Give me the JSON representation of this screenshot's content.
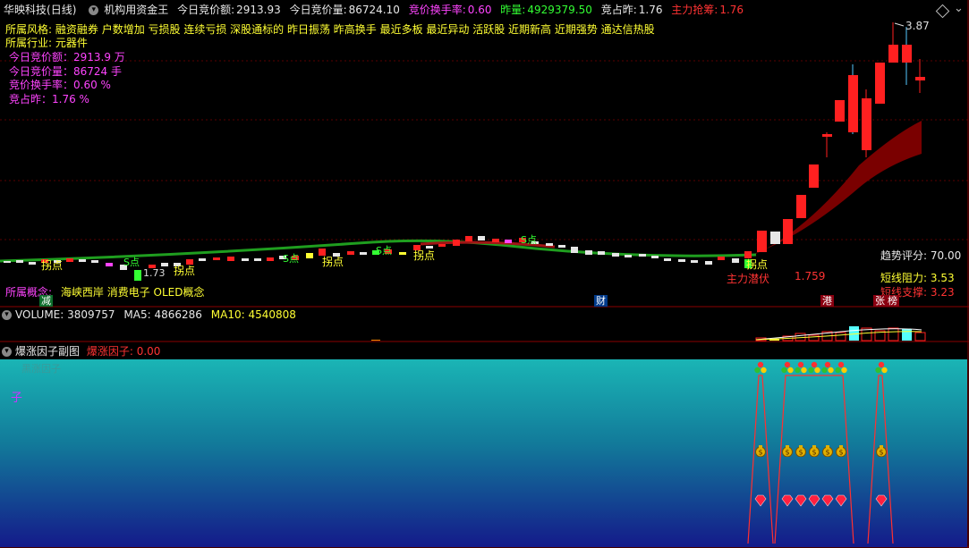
{
  "header": {
    "stock_name": "华映科技",
    "period": "(日线)",
    "indicator": "机构用资金王",
    "open_amount_label": "今日竞价额:",
    "open_amount": "2913.93",
    "open_volume_label": "今日竞价量:",
    "open_volume": "86724.10",
    "turnover_label": "竞价换手率:",
    "turnover": "0.60",
    "prev_volume_label": "昨量:",
    "prev_volume": "4929379.50",
    "ratio_label": "竞占昨:",
    "ratio": "1.76",
    "main_label": "主力抢筹:",
    "main_value": "1.76"
  },
  "info": {
    "style_label": "所属风格:",
    "style_value": "融资融券 户数增加 亏损股 连续亏损 深股通标的 昨日振荡 昨高换手 最近多板 最近异动 活跃股 近期新高 近期强势 通达信热股",
    "industry_label": "所属行业:",
    "industry_value": "元器件",
    "amount_line": "今日竞价额：2913.9 万",
    "volume_line": "今日竞价量：86724 手",
    "turnover_line": "竞价换手率：0.60 %",
    "ratio_line": "竞占昨：1.76 %",
    "concept_label": "所属概念:",
    "concept_value": "海峡西岸 消费电子 OLED概念"
  },
  "chart_annotations": {
    "high_price": "3.87",
    "low_price": "1.73",
    "main_price": "1.759",
    "guai_label": "拐点",
    "s_label": "S点",
    "b_label": "B点",
    "main_lurk": "主力潜伏",
    "score_label": "趋势评分:",
    "score_value": "70.00",
    "resist_label": "短线阻力:",
    "resist_value": "3.53",
    "support_label": "短线支撑:",
    "support_value": "3.23",
    "tag_jian": "减",
    "tag_cai": "财",
    "tag_gang": "港",
    "tag_zhang": "张",
    "tag_bang": "榜"
  },
  "volume_panel": {
    "label": "VOLUME:",
    "value": "3809757",
    "ma5_label": "MA5:",
    "ma5": "4866286",
    "ma10_label": "MA10:",
    "ma10": "4540808"
  },
  "sub_panel": {
    "title": "爆涨因子副图",
    "factor_label": "爆涨因子:",
    "factor_value": "0.00",
    "watermark": "黑涨因子",
    "side_char": "子"
  },
  "colors": {
    "up": "#ff2020",
    "down": "#e6e6e6",
    "accent_pink": "#ff44ff",
    "accent_yellow": "#ffff33"
  },
  "chart_data": {
    "type": "candlestick",
    "title": "",
    "xlabel": "",
    "ylabel": "",
    "high_marker": 3.87,
    "low_marker": 1.73
  }
}
